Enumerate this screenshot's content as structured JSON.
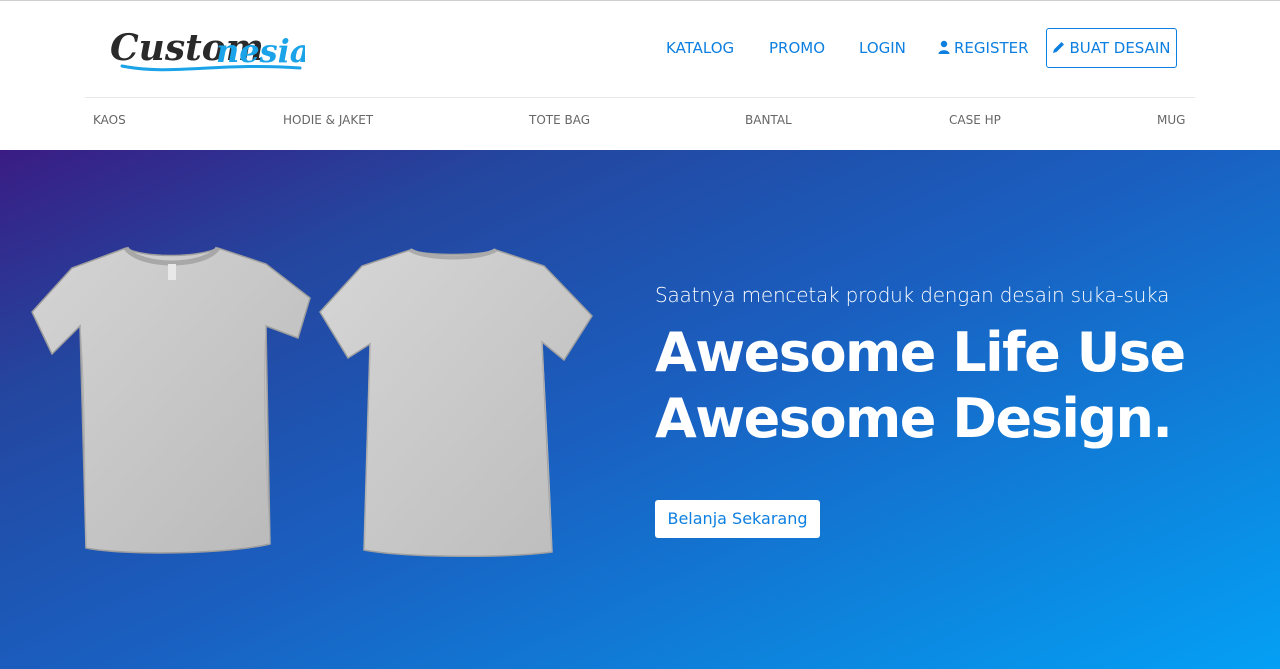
{
  "brand": {
    "logo_text_main": "Custom",
    "logo_text_accent": "nesia",
    "colors": {
      "dark": "#2a2a2a",
      "accent": "#1aa3e8"
    }
  },
  "nav": {
    "katalog": "KATALOG",
    "promo": "PROMO",
    "login": "LOGIN",
    "register": "REGISTER",
    "register_icon": "user-icon",
    "buat_desain": "BUAT DESAIN",
    "buat_desain_icon": "pencil-icon"
  },
  "categories": [
    "KAOS",
    "HODIE & JAKET",
    "TOTE BAG",
    "BANTAL",
    "CASE HP",
    "MUG"
  ],
  "hero": {
    "subtitle": "Saatnya mencetak produk dengan desain suka-suka",
    "title_line1": "Awesome Life Use",
    "title_line2": "Awesome Design.",
    "cta": "Belanja Sekarang",
    "images": [
      "tshirt-front-image",
      "tshirt-back-image"
    ]
  },
  "colors": {
    "link": "#0d7fe0",
    "hero_gradient_start": "#3a1c84",
    "hero_gradient_end": "#04a0f5",
    "shirt": "#c9c9c9"
  }
}
